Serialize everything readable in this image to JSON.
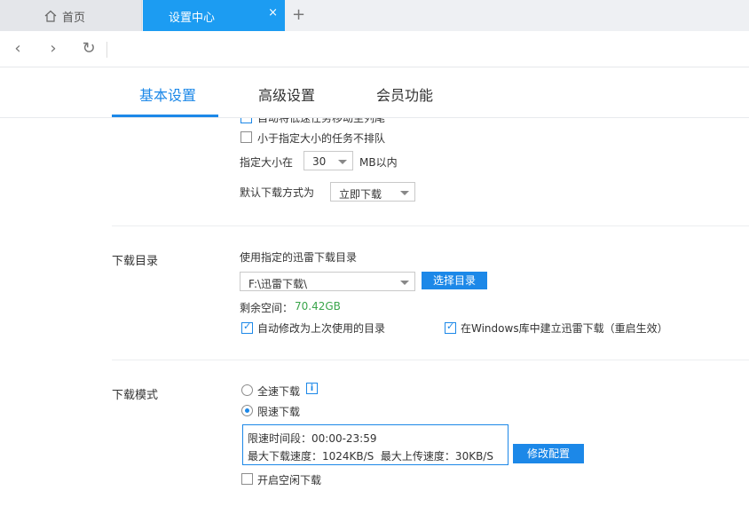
{
  "tabs": [
    {
      "label": "首页",
      "icon": "home-icon"
    },
    {
      "label": "设置中心",
      "close": "×"
    }
  ],
  "newtab": "+",
  "nav": {
    "back": "‹",
    "forward": "›",
    "refresh": "↻"
  },
  "settings_tabs": [
    "基本设置",
    "高级设置",
    "会员功能"
  ],
  "task": {
    "truncated_label": "自动将低速任务移动至列尾",
    "small_no_queue": "小于指定大小的任务不排队",
    "size_label": "指定大小在",
    "size_value": "30",
    "size_unit": "MB以内",
    "default_mode_label": "默认下载方式为",
    "default_mode_value": "立即下载"
  },
  "dir": {
    "section": "下载目录",
    "use_label": "使用指定的迅雷下载目录",
    "path": "F:\\迅雷下载\\",
    "choose_btn": "选择目录",
    "free_label": "剩余空间：",
    "free_value": "70.42GB",
    "auto_modify": "自动修改为上次使用的目录",
    "win_lib": "在Windows库中建立迅雷下载（重启生效）"
  },
  "mode": {
    "section": "下载模式",
    "full_speed": "全速下载",
    "info": "i",
    "limited": "限速下载",
    "period": "限速时间段：00:00-23:59",
    "speeds": "最大下载速度：1024KB/S  最大上传速度：30KB/S",
    "modify_btn": "修改配置",
    "idle": "开启空闲下载"
  },
  "colors": {
    "accent": "#1c88e8",
    "tab_active": "#1c9cf2",
    "free_space": "#3aa54b"
  }
}
